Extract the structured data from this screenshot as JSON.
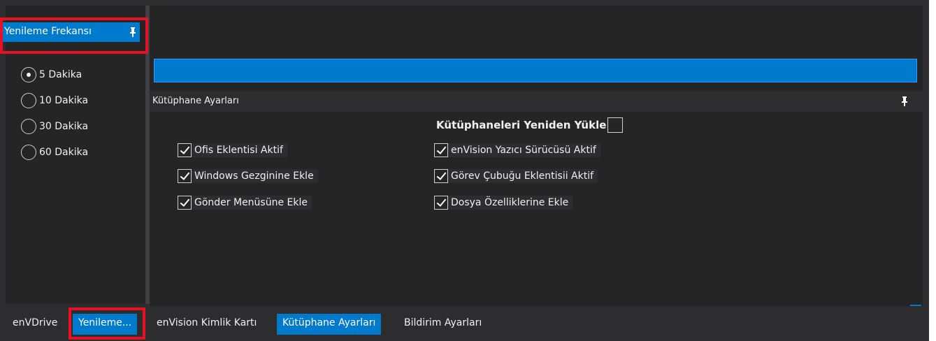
{
  "left_panel": {
    "title": "Yenileme Frekansı",
    "pin_icon": "pin-icon",
    "options": [
      {
        "label": "5 Dakika",
        "checked": true
      },
      {
        "label": "10 Dakika",
        "checked": false
      },
      {
        "label": "30 Dakika",
        "checked": false
      },
      {
        "label": "60 Dakika",
        "checked": false
      }
    ]
  },
  "library_panel": {
    "title": "Kütüphane Ayarları",
    "pin_icon": "pin-icon",
    "reload_label": "Kütüphaneleri Yeniden Yükle",
    "reload_checked": false,
    "checkboxes_left": [
      {
        "label": "Ofis Eklentisi Aktif",
        "checked": true
      },
      {
        "label": "Windows Gezginine Ekle",
        "checked": true
      },
      {
        "label": "Gönder Menüsüne Ekle",
        "checked": true
      }
    ],
    "checkboxes_right": [
      {
        "label": "enVision Yazıcı Sürücüsü Aktif",
        "checked": true
      },
      {
        "label": "Görev Çubuğu Eklentisii Aktif",
        "checked": true
      },
      {
        "label": "Dosya Özelliklerine Ekle",
        "checked": true
      }
    ]
  },
  "bottom_tabs": {
    "left": [
      {
        "label": "enVDrive",
        "active": false
      },
      {
        "label": "Yenileme...",
        "active": true
      }
    ],
    "right": [
      {
        "label": "enVision Kimlik Kartı",
        "active": false
      },
      {
        "label": "Kütüphane Ayarları",
        "active": true
      },
      {
        "label": "Bildirim Ayarları",
        "active": false
      }
    ]
  },
  "colors": {
    "accent": "#007acc",
    "background": "#2d2d30",
    "panel": "#252526",
    "highlight": "#e81123"
  }
}
